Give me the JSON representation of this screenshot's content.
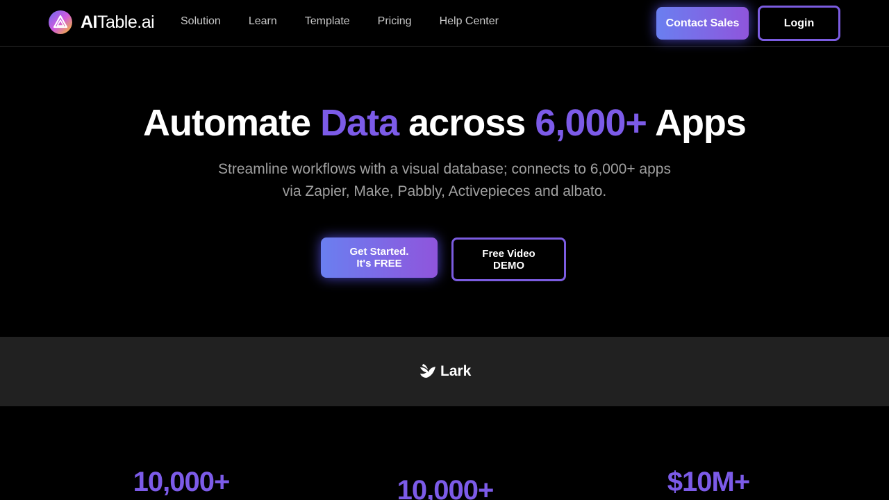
{
  "header": {
    "logo_bold": "AI",
    "logo_rest": "Table.ai",
    "nav": [
      "Solution",
      "Learn",
      "Template",
      "Pricing",
      "Help Center"
    ],
    "contact_label": "Contact Sales",
    "login_label": "Login"
  },
  "hero": {
    "title_1": "Automate",
    "title_accent_1": "Data",
    "title_2": "across",
    "title_accent_2": "6,000+",
    "title_3": "Apps",
    "subtitle_line_1": "Streamline workflows with a visual database; connects to 6,000+ apps",
    "subtitle_line_2": "via Zapier, Make, Pabbly, Activepieces and albato.",
    "cta_primary_line_1": "Get Started.",
    "cta_primary_line_2": "It's FREE",
    "cta_secondary_line_1": "Free Video",
    "cta_secondary_line_2": "DEMO"
  },
  "partners": {
    "name": "Lark"
  },
  "stats": [
    "10,000+",
    "10,000+",
    "$10M+"
  ],
  "colors": {
    "accent": "#7c5be8",
    "band": "#212121",
    "background": "#000000"
  }
}
